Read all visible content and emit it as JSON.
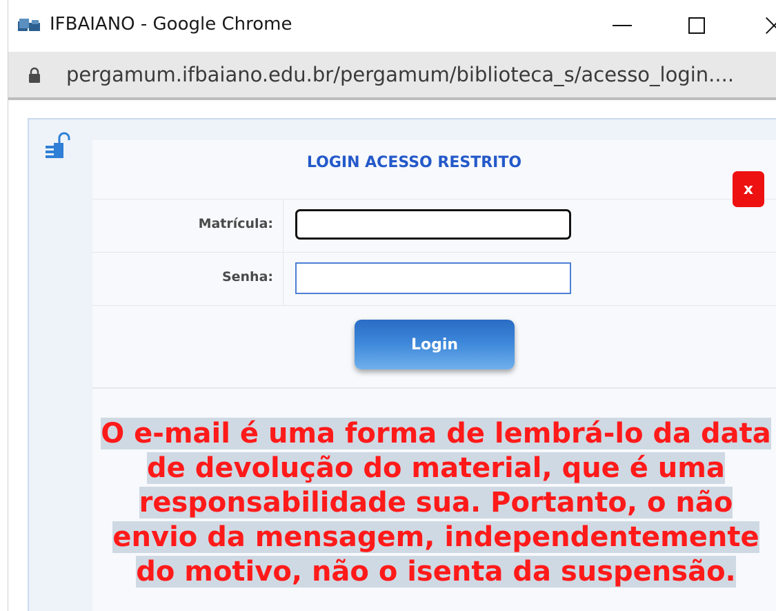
{
  "window": {
    "title": "IFBAIANO - Google Chrome"
  },
  "address_bar": {
    "url": "pergamum.ifbaiano.edu.br/pergamum/biblioteca_s/acesso_login...."
  },
  "login": {
    "title": "LOGIN ACESSO RESTRITO",
    "close_label": "x",
    "fields": [
      {
        "label": "Matrícula:",
        "value": ""
      },
      {
        "label": "Senha:",
        "value": ""
      }
    ],
    "button_label": "Login"
  },
  "notice": {
    "text": "O e-mail é uma forma de lembrá-lo da data de devolução do material, que é uma responsabilidade sua. Portanto, o não envio da mensagem, independentemente do motivo, não o isenta da suspensão."
  },
  "colors": {
    "title_blue": "#2459c9",
    "close_red": "#ee1111",
    "notice_red": "#ff1a1a",
    "notice_highlight": "#cfd9e3",
    "button_blue": "#3c86d9"
  },
  "icons": {
    "app": "ifbaiano-app-icon",
    "lock": "lock-icon",
    "login_side": "open-padlock-login-icon"
  }
}
